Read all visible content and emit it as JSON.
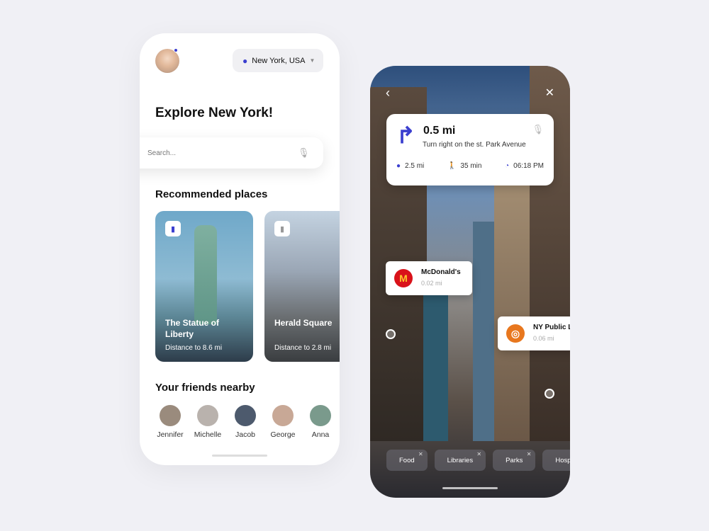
{
  "explore": {
    "location": "New York, USA",
    "title": "Explore New York!",
    "search_placeholder": "Search...",
    "recommended_heading": "Recommended places",
    "places": [
      {
        "name": "The Statue of Liberty",
        "distance": "Distance to 8.6 mi"
      },
      {
        "name": "Herald Square",
        "distance": "Distance to 2.8 mi"
      }
    ],
    "friends_heading": "Your friends nearby",
    "friends": [
      "Jennifer",
      "Michelle",
      "Jacob",
      "George",
      "Anna"
    ]
  },
  "navigation": {
    "distance": "0.5 mi",
    "instruction": "Turn right on the st. Park Avenue",
    "total": "2.5 mi",
    "time": "35 min",
    "eta": "06:18 PM",
    "pois": [
      {
        "name": "McDonald's",
        "distance": "0.02 mi",
        "color": "#d9121a"
      },
      {
        "name": "NY Public Library",
        "distance": "0.06 mi",
        "color": "#e8771e"
      }
    ],
    "filters": [
      "Food",
      "Libraries",
      "Parks",
      "Hospital"
    ]
  },
  "colors": {
    "accent": "#3b3fcf"
  }
}
